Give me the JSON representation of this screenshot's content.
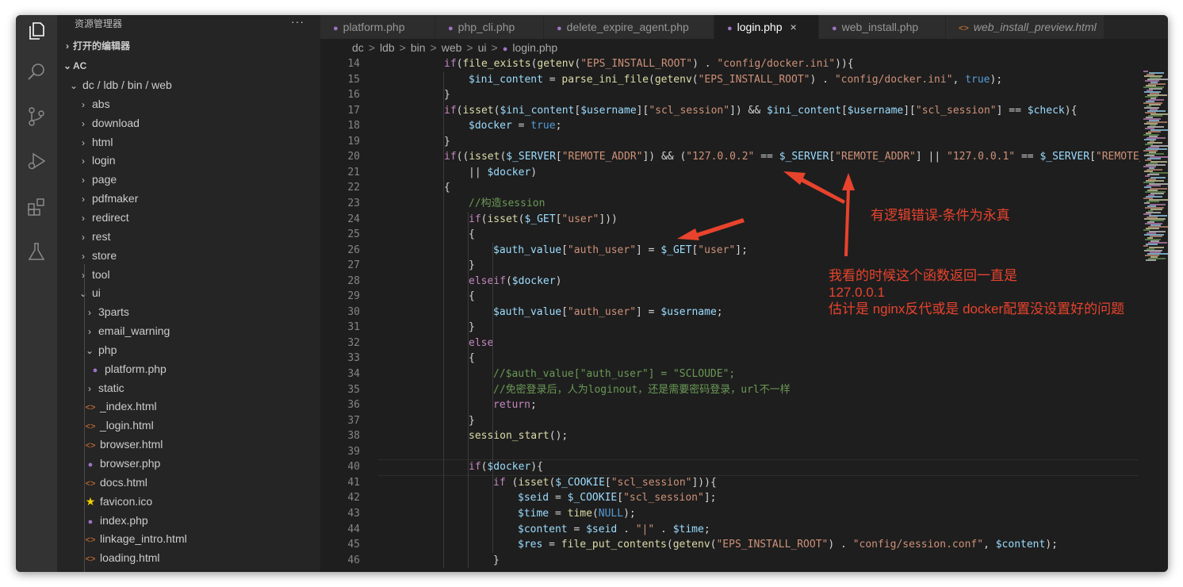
{
  "explorer": {
    "title": "资源管理器",
    "more": "···",
    "sections": [
      {
        "label": "打开的编辑器",
        "expanded": false
      },
      {
        "label": "AC",
        "expanded": true
      }
    ],
    "tree": [
      {
        "label": "dc / ldb / bin / web",
        "level": 1,
        "kind": "folder",
        "expanded": true
      },
      {
        "label": "abs",
        "level": 2,
        "kind": "folder",
        "expanded": false
      },
      {
        "label": "download",
        "level": 2,
        "kind": "folder",
        "expanded": false
      },
      {
        "label": "html",
        "level": 2,
        "kind": "folder",
        "expanded": false
      },
      {
        "label": "login",
        "level": 2,
        "kind": "folder",
        "expanded": false
      },
      {
        "label": "page",
        "level": 2,
        "kind": "folder",
        "expanded": false
      },
      {
        "label": "pdfmaker",
        "level": 2,
        "kind": "folder",
        "expanded": false
      },
      {
        "label": "redirect",
        "level": 2,
        "kind": "folder",
        "expanded": false
      },
      {
        "label": "rest",
        "level": 2,
        "kind": "folder",
        "expanded": false
      },
      {
        "label": "store",
        "level": 2,
        "kind": "folder",
        "expanded": false
      },
      {
        "label": "tool",
        "level": 2,
        "kind": "folder",
        "expanded": false
      },
      {
        "label": "ui",
        "level": 2,
        "kind": "folder",
        "expanded": true
      },
      {
        "label": "3parts",
        "level": 3,
        "kind": "folder",
        "expanded": false
      },
      {
        "label": "email_warning",
        "level": 3,
        "kind": "folder",
        "expanded": false
      },
      {
        "label": "php",
        "level": 3,
        "kind": "folder",
        "expanded": true
      },
      {
        "label": "platform.php",
        "level": 4,
        "kind": "php"
      },
      {
        "label": "static",
        "level": 3,
        "kind": "folder",
        "expanded": false
      },
      {
        "label": "_index.html",
        "level": 3,
        "kind": "html"
      },
      {
        "label": "_login.html",
        "level": 3,
        "kind": "html"
      },
      {
        "label": "browser.html",
        "level": 3,
        "kind": "html"
      },
      {
        "label": "browser.php",
        "level": 3,
        "kind": "php"
      },
      {
        "label": "docs.html",
        "level": 3,
        "kind": "html"
      },
      {
        "label": "favicon.ico",
        "level": 3,
        "kind": "ico"
      },
      {
        "label": "index.php",
        "level": 3,
        "kind": "php"
      },
      {
        "label": "linkage_intro.html",
        "level": 3,
        "kind": "html"
      },
      {
        "label": "loading.html",
        "level": 3,
        "kind": "html"
      }
    ]
  },
  "tabs": [
    {
      "label": "platform.php",
      "kind": "php",
      "active": false,
      "italic": false
    },
    {
      "label": "php_cli.php",
      "kind": "php",
      "active": false,
      "italic": false
    },
    {
      "label": "delete_expire_agent.php",
      "kind": "php",
      "active": false,
      "italic": false
    },
    {
      "label": "login.php",
      "kind": "php",
      "active": true,
      "italic": false
    },
    {
      "label": "web_install.php",
      "kind": "php",
      "active": false,
      "italic": false
    },
    {
      "label": "web_install_preview.html",
      "kind": "html",
      "active": false,
      "italic": true
    }
  ],
  "tab_close_glyph": "×",
  "breadcrumb": [
    "dc",
    "ldb",
    "bin",
    "web",
    "ui",
    "login.php"
  ],
  "breadcrumb_sep": ">",
  "code": {
    "first_line": 14,
    "lines": [
      [
        [
          1,
          "if",
          "kw"
        ],
        [
          0,
          "(",
          ""
        ],
        [
          0,
          "file_exists",
          "fn"
        ],
        [
          0,
          "(",
          ""
        ],
        [
          0,
          "getenv",
          "fn"
        ],
        [
          0,
          "(",
          ""
        ],
        [
          0,
          "\"EPS_INSTALL_ROOT\"",
          "st"
        ],
        [
          0,
          ") . ",
          ""
        ],
        [
          0,
          "\"config/docker.ini\"",
          "st"
        ],
        [
          0,
          ")){",
          ""
        ]
      ],
      [
        [
          2,
          "$ini_content",
          "vr"
        ],
        [
          0,
          " = ",
          ""
        ],
        [
          0,
          "parse_ini_file",
          "fn"
        ],
        [
          0,
          "(",
          ""
        ],
        [
          0,
          "getenv",
          "fn"
        ],
        [
          0,
          "(",
          ""
        ],
        [
          0,
          "\"EPS_INSTALL_ROOT\"",
          "st"
        ],
        [
          0,
          ") . ",
          ""
        ],
        [
          0,
          "\"config/docker.ini\"",
          "st"
        ],
        [
          0,
          ", ",
          ""
        ],
        [
          0,
          "true",
          "bl"
        ],
        [
          0,
          ");",
          ""
        ]
      ],
      [
        [
          1,
          "}",
          ""
        ]
      ],
      [
        [
          1,
          "if",
          "kw"
        ],
        [
          0,
          "(",
          ""
        ],
        [
          0,
          "isset",
          "fn"
        ],
        [
          0,
          "(",
          ""
        ],
        [
          0,
          "$ini_content",
          "vr"
        ],
        [
          0,
          "[",
          ""
        ],
        [
          0,
          "$username",
          "vr"
        ],
        [
          0,
          "][",
          ""
        ],
        [
          0,
          "\"scl_session\"",
          "st"
        ],
        [
          0,
          "]) && ",
          ""
        ],
        [
          0,
          "$ini_content",
          "vr"
        ],
        [
          0,
          "[",
          ""
        ],
        [
          0,
          "$username",
          "vr"
        ],
        [
          0,
          "][",
          ""
        ],
        [
          0,
          "\"scl_session\"",
          "st"
        ],
        [
          0,
          "] == ",
          ""
        ],
        [
          0,
          "$check",
          "vr"
        ],
        [
          0,
          "){",
          ""
        ]
      ],
      [
        [
          2,
          "$docker",
          "vr"
        ],
        [
          0,
          " = ",
          ""
        ],
        [
          0,
          "true",
          "bl"
        ],
        [
          0,
          ";",
          ""
        ]
      ],
      [
        [
          1,
          "}",
          ""
        ]
      ],
      [
        [
          1,
          "if",
          "kw"
        ],
        [
          0,
          "((",
          ""
        ],
        [
          0,
          "isset",
          "fn"
        ],
        [
          0,
          "(",
          ""
        ],
        [
          0,
          "$_SERVER",
          "vr"
        ],
        [
          0,
          "[",
          ""
        ],
        [
          0,
          "\"REMOTE_ADDR\"",
          "st"
        ],
        [
          0,
          "]) && (",
          ""
        ],
        [
          0,
          "\"127.0.0.2\"",
          "st"
        ],
        [
          0,
          " == ",
          ""
        ],
        [
          0,
          "$_SERVER",
          "vr"
        ],
        [
          0,
          "[",
          ""
        ],
        [
          0,
          "\"REMOTE_ADDR\"",
          "st"
        ],
        [
          0,
          "] || ",
          ""
        ],
        [
          0,
          "\"127.0.0.1\"",
          "st"
        ],
        [
          0,
          " == ",
          ""
        ],
        [
          0,
          "$_SERVER",
          "vr"
        ],
        [
          0,
          "[",
          ""
        ],
        [
          0,
          "\"REMOTE_AD",
          "st"
        ]
      ],
      [
        [
          2,
          "|| ",
          ""
        ],
        [
          0,
          "$docker",
          "vr"
        ],
        [
          0,
          ")",
          ""
        ]
      ],
      [
        [
          1,
          "{",
          ""
        ]
      ],
      [
        [
          2,
          "//构造session",
          "cm"
        ]
      ],
      [
        [
          2,
          "if",
          "kw"
        ],
        [
          0,
          "(",
          ""
        ],
        [
          0,
          "isset",
          "fn"
        ],
        [
          0,
          "(",
          ""
        ],
        [
          0,
          "$_GET",
          "vr"
        ],
        [
          0,
          "[",
          ""
        ],
        [
          0,
          "\"user\"",
          "st"
        ],
        [
          0,
          "]))",
          ""
        ]
      ],
      [
        [
          2,
          "{",
          ""
        ]
      ],
      [
        [
          3,
          "$auth_value",
          "vr"
        ],
        [
          0,
          "[",
          ""
        ],
        [
          0,
          "\"auth_user\"",
          "st"
        ],
        [
          0,
          "] = ",
          ""
        ],
        [
          0,
          "$_GET",
          "vr"
        ],
        [
          0,
          "[",
          ""
        ],
        [
          0,
          "\"user\"",
          "st"
        ],
        [
          0,
          "];",
          ""
        ]
      ],
      [
        [
          2,
          "}",
          ""
        ]
      ],
      [
        [
          2,
          "elseif",
          "kw"
        ],
        [
          0,
          "(",
          ""
        ],
        [
          0,
          "$docker",
          "vr"
        ],
        [
          0,
          ")",
          ""
        ]
      ],
      [
        [
          2,
          "{",
          ""
        ]
      ],
      [
        [
          3,
          "$auth_value",
          "vr"
        ],
        [
          0,
          "[",
          ""
        ],
        [
          0,
          "\"auth_user\"",
          "st"
        ],
        [
          0,
          "] = ",
          ""
        ],
        [
          0,
          "$username",
          "vr"
        ],
        [
          0,
          ";",
          ""
        ]
      ],
      [
        [
          2,
          "}",
          ""
        ]
      ],
      [
        [
          2,
          "else",
          "kw"
        ]
      ],
      [
        [
          2,
          "{",
          ""
        ]
      ],
      [
        [
          3,
          "//$auth_value[\"auth_user\"] = \"SCLOUDE\";",
          "cm"
        ]
      ],
      [
        [
          3,
          "//免密登录后，人为loginout，还是需要密码登录，url不一样",
          "cm"
        ]
      ],
      [
        [
          3,
          "return",
          "kw"
        ],
        [
          0,
          ";",
          ""
        ]
      ],
      [
        [
          2,
          "}",
          ""
        ]
      ],
      [
        [
          2,
          "session_start",
          "fn"
        ],
        [
          0,
          "();",
          ""
        ]
      ],
      [
        [
          0,
          "",
          ""
        ]
      ],
      [
        [
          2,
          "if",
          "kw"
        ],
        [
          0,
          "(",
          ""
        ],
        [
          0,
          "$docker",
          "vr"
        ],
        [
          0,
          "){",
          ""
        ]
      ],
      [
        [
          3,
          "if ",
          "kw"
        ],
        [
          0,
          "(",
          ""
        ],
        [
          0,
          "isset",
          "fn"
        ],
        [
          0,
          "(",
          ""
        ],
        [
          0,
          "$_COOKIE",
          "vr"
        ],
        [
          0,
          "[",
          ""
        ],
        [
          0,
          "\"scl_session\"",
          "st"
        ],
        [
          0,
          "])){",
          ""
        ]
      ],
      [
        [
          4,
          "$seid",
          "vr"
        ],
        [
          0,
          " = ",
          ""
        ],
        [
          0,
          "$_COOKIE",
          "vr"
        ],
        [
          0,
          "[",
          ""
        ],
        [
          0,
          "\"scl_session\"",
          "st"
        ],
        [
          0,
          "];",
          ""
        ]
      ],
      [
        [
          4,
          "$time",
          "vr"
        ],
        [
          0,
          " = ",
          ""
        ],
        [
          0,
          "time",
          "fn"
        ],
        [
          0,
          "(",
          ""
        ],
        [
          0,
          "NULL",
          "bl"
        ],
        [
          0,
          ");",
          ""
        ]
      ],
      [
        [
          4,
          "$content",
          "vr"
        ],
        [
          0,
          " = ",
          ""
        ],
        [
          0,
          "$seid",
          "vr"
        ],
        [
          0,
          " . ",
          ""
        ],
        [
          0,
          "\"|\"",
          "st"
        ],
        [
          0,
          " . ",
          ""
        ],
        [
          0,
          "$time",
          "vr"
        ],
        [
          0,
          ";",
          ""
        ]
      ],
      [
        [
          4,
          "$res",
          "vr"
        ],
        [
          0,
          " = ",
          ""
        ],
        [
          0,
          "file_put_contents",
          "fn"
        ],
        [
          0,
          "(",
          ""
        ],
        [
          0,
          "getenv",
          "fn"
        ],
        [
          0,
          "(",
          ""
        ],
        [
          0,
          "\"EPS_INSTALL_ROOT\"",
          "st"
        ],
        [
          0,
          ") . ",
          ""
        ],
        [
          0,
          "\"config/session.conf\"",
          "st"
        ],
        [
          0,
          ", ",
          ""
        ],
        [
          0,
          "$content",
          "vr"
        ],
        [
          0,
          ");",
          ""
        ]
      ],
      [
        [
          3,
          "}",
          ""
        ]
      ]
    ]
  },
  "annotations": {
    "note1": "有逻辑错误-条件为永真",
    "note2_lines": [
      "我看的时候这个函数返回一直是",
      "127.0.0.1",
      "估计是 nginx反代或是 docker配置没设置好的问题"
    ],
    "color": "#e8432d"
  },
  "colors": {
    "editor_bg": "#1e1e1e",
    "sidebar_bg": "#252526",
    "activity_bg": "#333333",
    "accent": "#e8432d"
  }
}
